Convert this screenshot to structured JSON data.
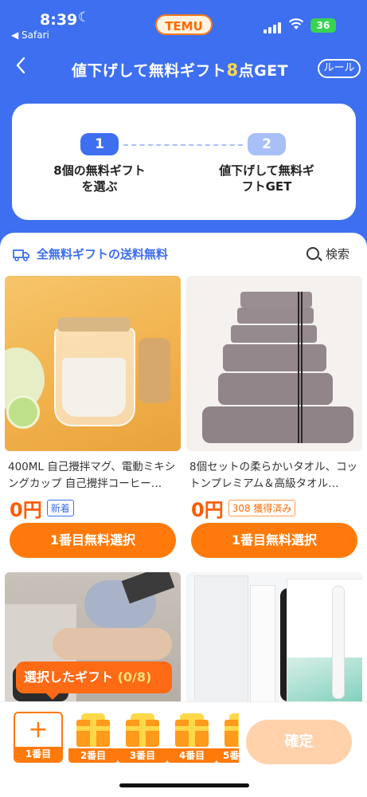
{
  "status_bar": {
    "time": "8:39",
    "back_app": "◀ Safari",
    "brand": "TEMU",
    "battery": "36"
  },
  "nav": {
    "title_prefix": "値下げして無料ギフト",
    "title_highlight": "8",
    "title_suffix": "点GET",
    "rule_label": "ルール"
  },
  "steps": [
    {
      "number": "1",
      "text_line1": "8個の無料ギフト",
      "text_line2": "を選ぶ"
    },
    {
      "number": "2",
      "text_line1": "値下げして無料ギ",
      "text_line2": "フトGET"
    }
  ],
  "shipping_label": "全無料ギフトの送料無料",
  "search_label": "検索",
  "products": [
    {
      "title": "400ML 自己攪拌マグ、電動ミキシングカップ 自己攪拌コーヒー…",
      "price": "0円",
      "tag": "新着",
      "button": "1番目無料選択"
    },
    {
      "title": "8個セットの柔らかいタオル、コットンプレミアム＆高級タオル…",
      "price": "0円",
      "tag": "308 獲得済み",
      "button": "1番目無料選択"
    }
  ],
  "gift_popup": {
    "label": "選択したギフト",
    "count": "(0/8)"
  },
  "slots": [
    "1番目",
    "2番目",
    "3番目",
    "4番目",
    "5番"
  ],
  "confirm_label": "確定",
  "colors": {
    "brand_blue": "#3d6ff0",
    "accent_orange": "#ff7a0a",
    "price_orange": "#ff5a00"
  }
}
